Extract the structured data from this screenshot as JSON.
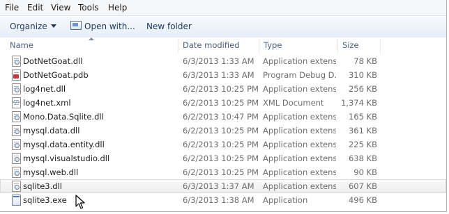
{
  "menu": [
    "File",
    "Edit",
    "View",
    "Tools",
    "Help"
  ],
  "toolbar": {
    "organize": "Organize",
    "open_with": "Open with...",
    "new_folder": "New folder"
  },
  "columns": {
    "name": "Name",
    "date": "Date modified",
    "type": "Type",
    "size": "Size"
  },
  "files": [
    {
      "name": "DotNetGoat.dll",
      "date": "6/3/2013 1:33 AM",
      "type": "Application extens...",
      "size": "78 KB",
      "icon": "dll-file-icon"
    },
    {
      "name": "DotNetGoat.pdb",
      "date": "6/3/2013 1:33 AM",
      "type": "Program Debug D...",
      "size": "310 KB",
      "icon": "pdb-file-icon"
    },
    {
      "name": "log4net.dll",
      "date": "6/2/2013 10:25 PM",
      "type": "Application extens...",
      "size": "256 KB",
      "icon": "dll-file-icon"
    },
    {
      "name": "log4net.xml",
      "date": "6/2/2013 10:25 PM",
      "type": "XML Document",
      "size": "1,374 KB",
      "icon": "xml-file-icon"
    },
    {
      "name": "Mono.Data.Sqlite.dll",
      "date": "6/2/2013 10:47 PM",
      "type": "Application extens...",
      "size": "165 KB",
      "icon": "dll-file-icon"
    },
    {
      "name": "mysql.data.dll",
      "date": "6/2/2013 10:25 PM",
      "type": "Application extens...",
      "size": "361 KB",
      "icon": "dll-file-icon"
    },
    {
      "name": "mysql.data.entity.dll",
      "date": "6/2/2013 10:25 PM",
      "type": "Application extens...",
      "size": "225 KB",
      "icon": "dll-file-icon"
    },
    {
      "name": "mysql.visualstudio.dll",
      "date": "6/2/2013 10:25 PM",
      "type": "Application extens...",
      "size": "638 KB",
      "icon": "dll-file-icon"
    },
    {
      "name": "mysql.web.dll",
      "date": "6/2/2013 10:25 PM",
      "type": "Application extens...",
      "size": "90 KB",
      "icon": "dll-file-icon"
    },
    {
      "name": "sqlite3.dll",
      "date": "6/3/2013 1:37 AM",
      "type": "Application extens...",
      "size": "607 KB",
      "icon": "dll-file-icon",
      "selected": true
    },
    {
      "name": "sqlite3.exe",
      "date": "6/3/2013 1:38 AM",
      "type": "Application",
      "size": "496 KB",
      "icon": "exe-file-icon"
    }
  ]
}
